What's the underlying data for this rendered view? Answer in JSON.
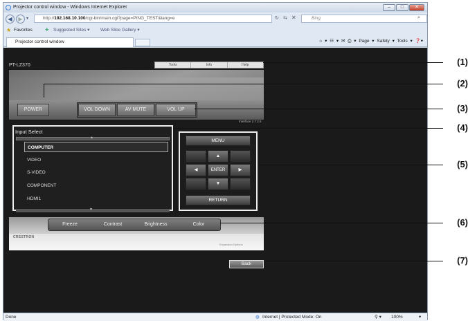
{
  "browser": {
    "title": "Projector control window - Windows Internet Explorer",
    "url_prefix": "http://",
    "url_host": "192.168.10.100",
    "url_path": "/cgi-bin/main.cgi?page=PING_TEST&lang=e",
    "search_placeholder": "Bing",
    "favorites_label": "Favorites",
    "suggested_sites": "Suggested Sites ▾",
    "web_slice": "Web Slice Gallery ▾",
    "tab_title": "Projector control window",
    "cmd_page": "Page ▾",
    "cmd_safety": "Safety ▾",
    "cmd_tools": "Tools ▾",
    "status_done": "Done",
    "status_zone": "Internet | Protected Mode: On",
    "zoom": "100%"
  },
  "device": {
    "name": "PT-LZ370",
    "top_menu": [
      "Tools",
      "Info",
      "Help"
    ],
    "power_label": "POWER",
    "vol_down_label": "VOL DOWN",
    "av_mute_label": "AV MUTE",
    "vol_up_label": "VOL UP",
    "interface_version": "Interface 2.7.2.6",
    "input_select_title": "Input Select",
    "inputs": [
      "COMPUTER",
      "VIDEO",
      "S-VIDEO",
      "COMPONENT",
      "HDMI1"
    ],
    "selected_input": "COMPUTER",
    "nav": {
      "menu": "MENU",
      "up": "▲",
      "left": "◀",
      "enter": "ENTER",
      "right": "▶",
      "down": "▼",
      "return": "RETURN"
    },
    "effects": [
      "Freeze",
      "Contrast",
      "Brightness",
      "Color"
    ],
    "crestron_logo": "CRESTRON",
    "expansion_options": "Expansion Options",
    "back_label": "Back"
  },
  "callouts": [
    "(1)",
    "(2)",
    "(3)",
    "(4)",
    "(5)",
    "(6)",
    "(7)"
  ]
}
